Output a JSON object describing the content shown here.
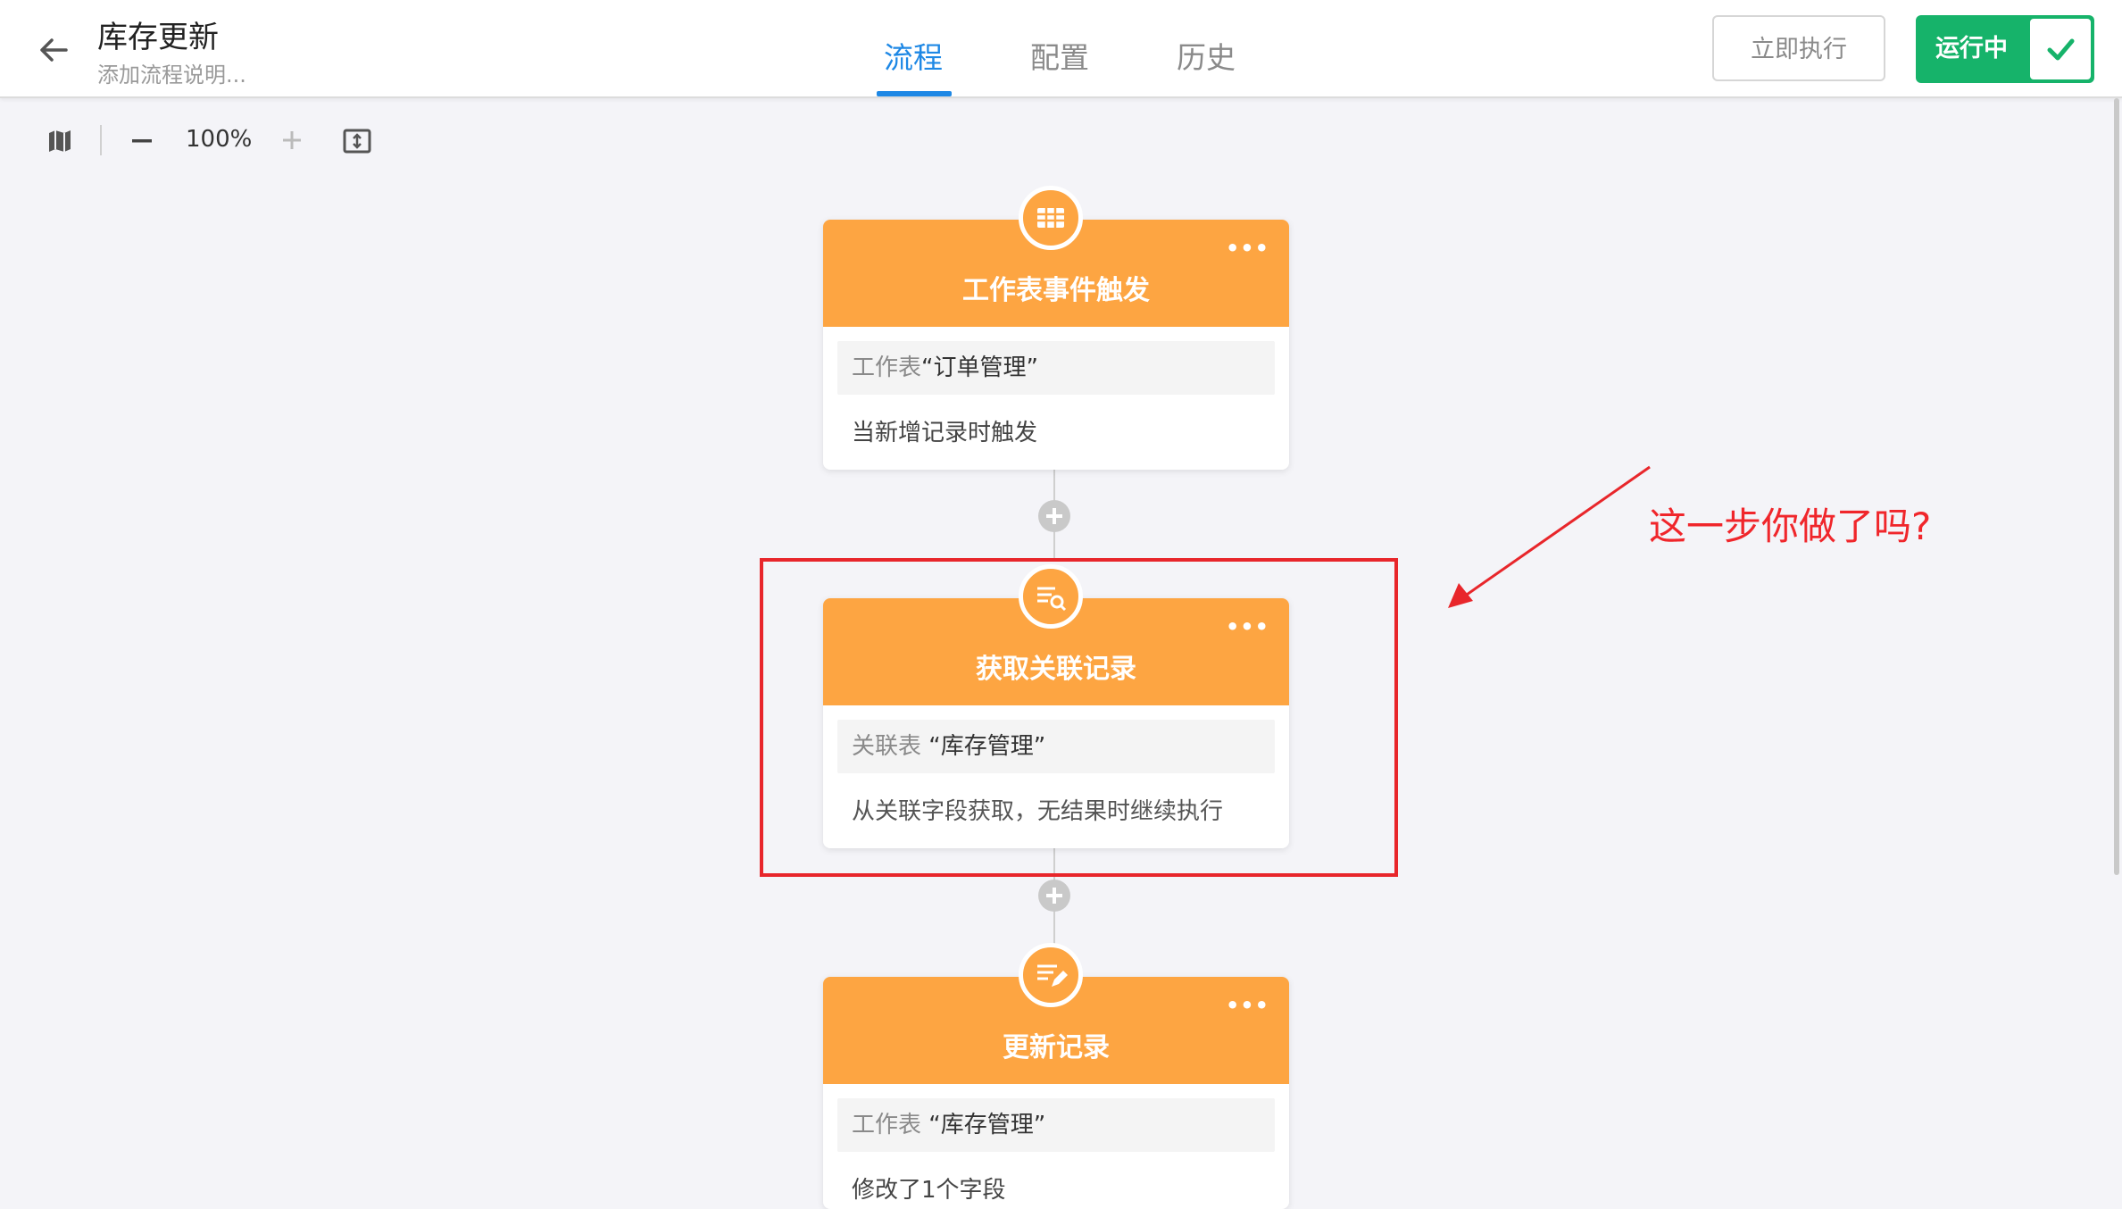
{
  "header": {
    "title": "库存更新",
    "subtitle": "添加流程说明...",
    "tabs": [
      {
        "label": "流程",
        "active": true
      },
      {
        "label": "配置",
        "active": false
      },
      {
        "label": "历史",
        "active": false
      }
    ],
    "run_now_label": "立即执行",
    "status_label": "运行中",
    "accent_color": "#1e88e5",
    "status_color": "#16b36a"
  },
  "toolbar": {
    "zoom_level": "100%"
  },
  "nodes": [
    {
      "icon": "table-icon",
      "title": "工作表事件触发",
      "detail_prefix": "工作表",
      "detail_value": "“订单管理”",
      "description": "当新增记录时触发"
    },
    {
      "icon": "search-records-icon",
      "title": "获取关联记录",
      "detail_prefix": "关联表",
      "detail_value": " “库存管理”",
      "description": "从关联字段获取，无结果时继续执行"
    },
    {
      "icon": "edit-records-icon",
      "title": "更新记录",
      "detail_prefix": "工作表",
      "detail_value": " “库存管理”",
      "description": "修改了1个字段"
    }
  ],
  "annotation": {
    "text": "这一步你做了吗?",
    "color": "#f0262b"
  },
  "node_color": "#fda542"
}
